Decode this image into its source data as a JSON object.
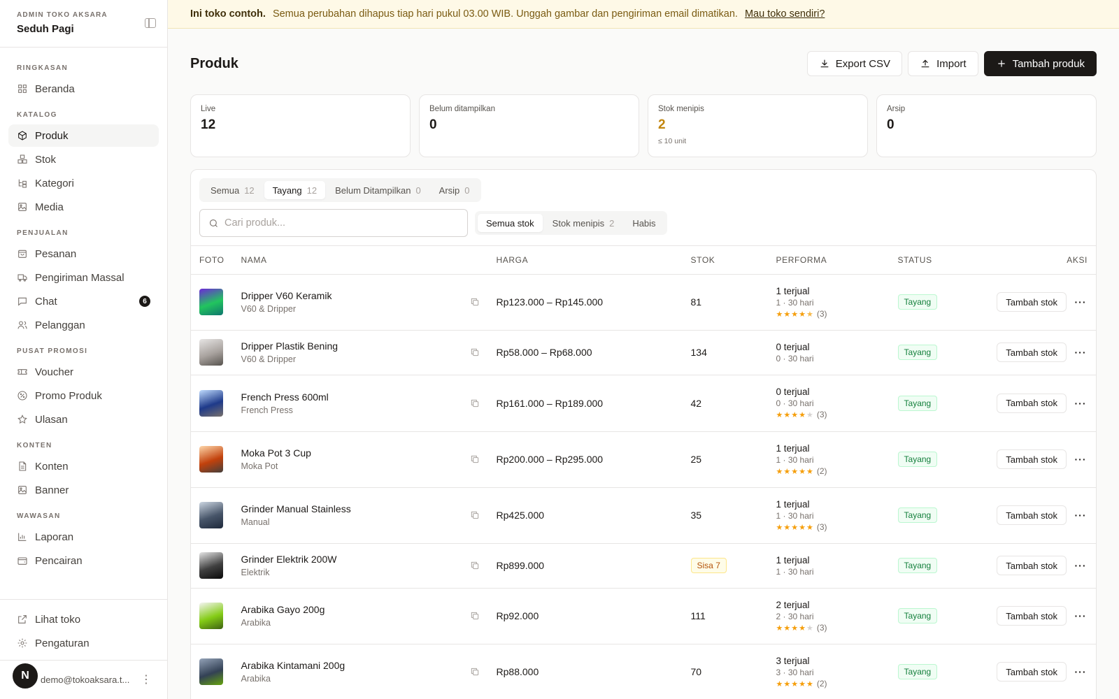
{
  "sidebar": {
    "eyebrow": "ADMIN TOKO AKSARA",
    "store_name": "Seduh Pagi",
    "sections": [
      {
        "title": "RINGKASAN",
        "items": [
          {
            "label": "Beranda",
            "icon": "grid-icon"
          }
        ]
      },
      {
        "title": "KATALOG",
        "items": [
          {
            "label": "Produk",
            "icon": "box-icon",
            "active": true
          },
          {
            "label": "Stok",
            "icon": "boxes-icon"
          },
          {
            "label": "Kategori",
            "icon": "tree-icon"
          },
          {
            "label": "Media",
            "icon": "image-icon"
          }
        ]
      },
      {
        "title": "PENJUALAN",
        "items": [
          {
            "label": "Pesanan",
            "icon": "bag-icon"
          },
          {
            "label": "Pengiriman Massal",
            "icon": "truck-icon"
          },
          {
            "label": "Chat",
            "icon": "chat-icon",
            "badge": "6"
          },
          {
            "label": "Pelanggan",
            "icon": "users-icon"
          }
        ]
      },
      {
        "title": "PUSAT PROMOSI",
        "items": [
          {
            "label": "Voucher",
            "icon": "ticket-icon"
          },
          {
            "label": "Promo Produk",
            "icon": "percent-icon"
          },
          {
            "label": "Ulasan",
            "icon": "star-icon"
          }
        ]
      },
      {
        "title": "KONTEN",
        "items": [
          {
            "label": "Konten",
            "icon": "file-icon"
          },
          {
            "label": "Banner",
            "icon": "image-icon"
          }
        ]
      },
      {
        "title": "WAWASAN",
        "items": [
          {
            "label": "Laporan",
            "icon": "chart-icon"
          },
          {
            "label": "Pencairan",
            "icon": "wallet-icon"
          }
        ]
      }
    ],
    "footer_items": [
      {
        "label": "Lihat toko",
        "icon": "external-link-icon"
      },
      {
        "label": "Pengaturan",
        "icon": "gear-icon"
      }
    ],
    "user": {
      "initial": "N",
      "email": "demo@tokoaksara.t..."
    }
  },
  "banner": {
    "strong": "Ini toko contoh.",
    "text": "Semua perubahan dihapus tiap hari pukul 03.00 WIB. Unggah gambar dan pengiriman email dimatikan.",
    "link": "Mau toko sendiri?"
  },
  "page": {
    "title": "Produk",
    "export_label": "Export CSV",
    "import_label": "Import",
    "add_label": "Tambah produk"
  },
  "stats": [
    {
      "label": "Live",
      "value": "12"
    },
    {
      "label": "Belum ditampilkan",
      "value": "0"
    },
    {
      "label": "Stok menipis",
      "value": "2",
      "sub": "≤ 10 unit",
      "warn": true
    },
    {
      "label": "Arsip",
      "value": "0"
    }
  ],
  "tabs": [
    {
      "label": "Semua",
      "count": "12"
    },
    {
      "label": "Tayang",
      "count": "12",
      "active": true
    },
    {
      "label": "Belum Ditampilkan",
      "count": "0"
    },
    {
      "label": "Arsip",
      "count": "0"
    }
  ],
  "search": {
    "placeholder": "Cari produk..."
  },
  "stock_filters": [
    {
      "label": "Semua stok",
      "active": true
    },
    {
      "label": "Stok menipis",
      "count": "2"
    },
    {
      "label": "Habis"
    }
  ],
  "table": {
    "headers": {
      "foto": "FOTO",
      "nama": "NAMA",
      "harga": "HARGA",
      "stok": "STOK",
      "performa": "PERFORMA",
      "status": "STATUS",
      "aksi": "AKSI"
    },
    "action_label": "Tambah stok",
    "rows": [
      {
        "name": "Dripper V60 Keramik",
        "category": "V60 & Dripper",
        "price": "Rp123.000 – Rp145.000",
        "stock": "81",
        "sold": "1 terjual",
        "period": "1 · 30 hari",
        "rating": 4.5,
        "reviews": "(3)",
        "status": "Tayang",
        "thumb": [
          "#6d28d9",
          "#22c55e",
          "#0f766e"
        ]
      },
      {
        "name": "Dripper Plastik Bening",
        "category": "V60 & Dripper",
        "price": "Rp58.000 – Rp68.000",
        "stock": "134",
        "sold": "0 terjual",
        "period": "0 · 30 hari",
        "rating": null,
        "reviews": "",
        "status": "Tayang",
        "thumb": [
          "#e7e5e4",
          "#a8a29e",
          "#57534e"
        ]
      },
      {
        "name": "French Press 600ml",
        "category": "French Press",
        "price": "Rp161.000 – Rp189.000",
        "stock": "42",
        "sold": "0 terjual",
        "period": "0 · 30 hari",
        "rating": 4,
        "reviews": "(3)",
        "status": "Tayang",
        "thumb": [
          "#bfdbfe",
          "#1e3a8a",
          "#78716c"
        ]
      },
      {
        "name": "Moka Pot 3 Cup",
        "category": "Moka Pot",
        "price": "Rp200.000 – Rp295.000",
        "stock": "25",
        "sold": "1 terjual",
        "period": "1 · 30 hari",
        "rating": 5,
        "reviews": "(2)",
        "status": "Tayang",
        "thumb": [
          "#fed7aa",
          "#c2410c",
          "#44403c"
        ]
      },
      {
        "name": "Grinder Manual Stainless",
        "category": "Manual",
        "price": "Rp425.000",
        "stock": "35",
        "sold": "1 terjual",
        "period": "1 · 30 hari",
        "rating": 5,
        "reviews": "(3)",
        "status": "Tayang",
        "thumb": [
          "#cbd5e1",
          "#475569",
          "#1e293b"
        ]
      },
      {
        "name": "Grinder Elektrik 200W",
        "category": "Elektrik",
        "price": "Rp899.000",
        "stock": "Sisa 7",
        "low_stock": true,
        "sold": "1 terjual",
        "period": "1 · 30 hari",
        "rating": null,
        "reviews": "",
        "status": "Tayang",
        "thumb": [
          "#e5e5e5",
          "#404040",
          "#0a0a0a"
        ]
      },
      {
        "name": "Arabika Gayo 200g",
        "category": "Arabika",
        "price": "Rp92.000",
        "stock": "111",
        "sold": "2 terjual",
        "period": "2 · 30 hari",
        "rating": 4,
        "reviews": "(3)",
        "status": "Tayang",
        "thumb": [
          "#f5f5f4",
          "#84cc16",
          "#3f6212"
        ]
      },
      {
        "name": "Arabika Kintamani 200g",
        "category": "Arabika",
        "price": "Rp88.000",
        "stock": "70",
        "sold": "3 terjual",
        "period": "3 · 30 hari",
        "rating": 5,
        "reviews": "(2)",
        "status": "Tayang",
        "thumb": [
          "#94a3b8",
          "#334155",
          "#65a30d"
        ]
      }
    ]
  }
}
